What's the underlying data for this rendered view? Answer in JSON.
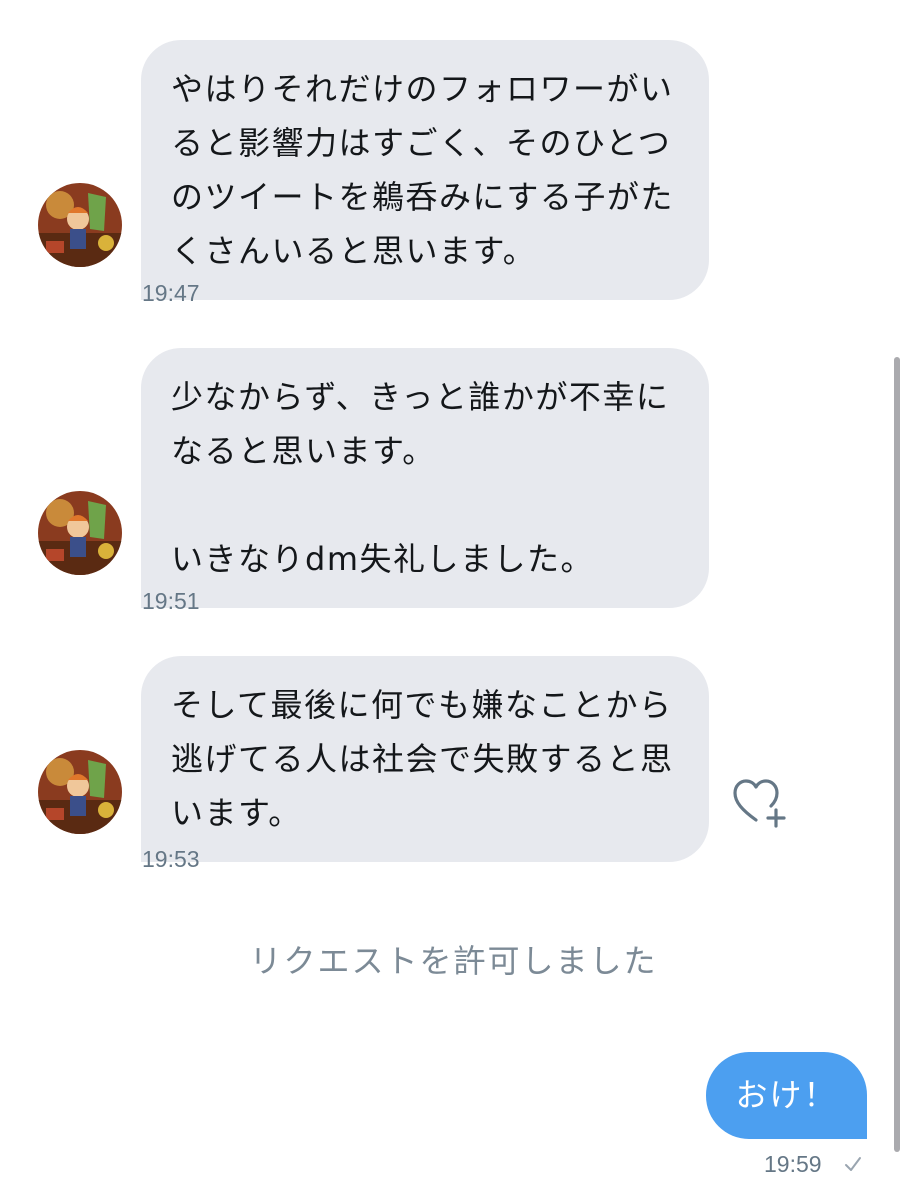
{
  "conversation": {
    "messages_in": [
      {
        "text": "やはりそれだけのフォロワーがいると影響力はすごく、そのひとつのツイートを鵜呑みにする子がたくさんいると思います。",
        "time": "19:47"
      },
      {
        "text": "少なからず、きっと誰かが不幸になると思います。\n\nいきなりdm失礼しました。",
        "time": "19:51"
      },
      {
        "text": "そして最後に何でも嫌なことから逃げてる人は社会で失敗すると思います。",
        "time": "19:53"
      }
    ],
    "system_message": "リクエストを許可しました",
    "message_out": {
      "text": "おけ！",
      "time": "19:59",
      "status_icon": "check-icon"
    }
  },
  "icons": {
    "like": "heart-plus-icon",
    "avatar": "avatar-illustration"
  },
  "colors": {
    "incoming_bubble": "#e7e9ee",
    "outgoing_bubble": "#4c9ff0",
    "timestamp": "#657786",
    "system_text": "#7c8a96"
  }
}
